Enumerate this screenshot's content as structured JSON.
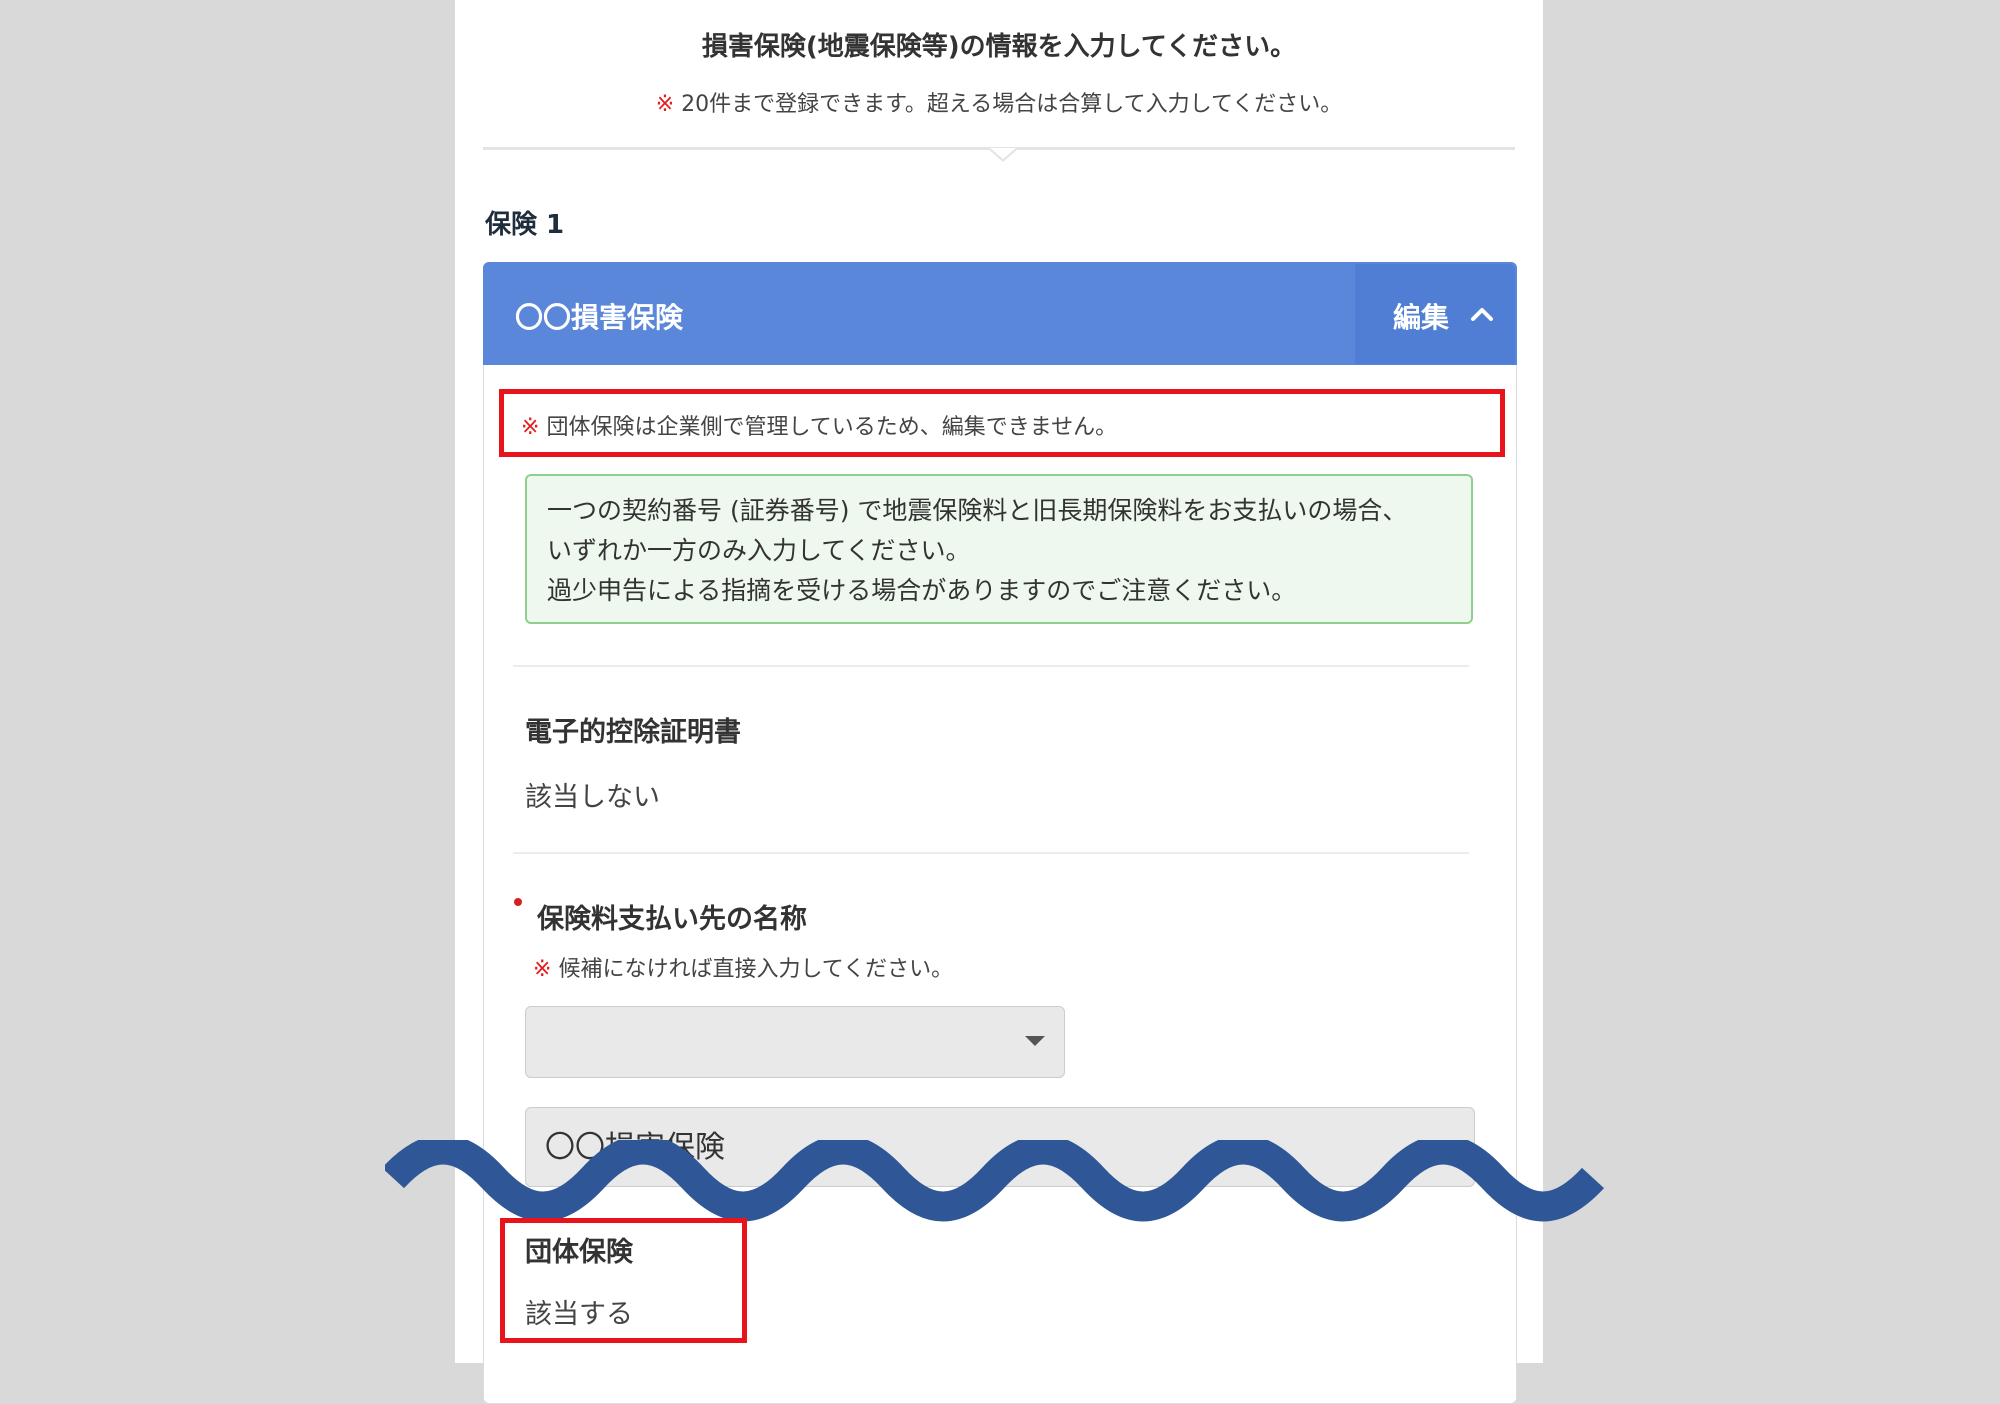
{
  "header": {
    "title": "損害保険(地震保険等)の情報を入力してください。",
    "note_mark": "※",
    "note": "20件まで登録できます。超える場合は合算して入力してください。"
  },
  "insurance": {
    "section_label": "保険 1",
    "card_title": "〇〇損害保険",
    "edit_label": "編集",
    "group_notice_mark": "※",
    "group_notice": "団体保険は企業側で管理しているため、編集できません。",
    "info_lines": [
      "一つの契約番号 (証券番号) で地震保険料と旧長期保険料をお支払いの場合、",
      "いずれか一方のみ入力してください。",
      "過少申告による指摘を受ける場合がありますのでご注意ください。"
    ],
    "electronic_cert": {
      "label": "電子的控除証明書",
      "value": "該当しない"
    },
    "payee": {
      "label": "保険料支払い先の名称",
      "note_mark": "※",
      "note": "候補になければ直接入力してください。",
      "select_value": "",
      "input_value": "〇〇損害保険"
    },
    "group_insurance": {
      "label": "団体保険",
      "value": "該当する"
    }
  },
  "colors": {
    "header_blue": "#5a87d9",
    "highlight_red": "#e8131b",
    "info_green_border": "#8fd08f",
    "wave_blue": "#2f5797"
  },
  "icons": {
    "edit_chevron": "chevron-up-icon",
    "select_arrow": "caret-down-icon"
  }
}
